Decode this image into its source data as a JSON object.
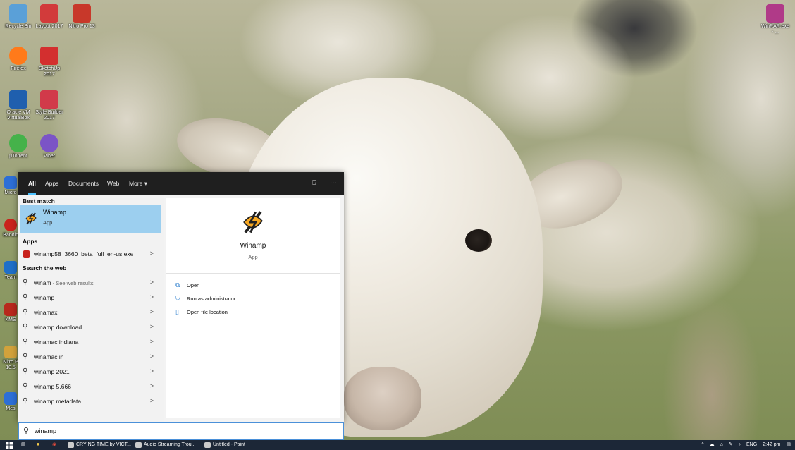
{
  "desktop": {
    "icons": [
      {
        "label": "Recycle Bin",
        "color": "#5aa0d8"
      },
      {
        "label": "Layout 2017",
        "color": "#d23b3b"
      },
      {
        "label": "Nitro Pro 13",
        "color": "#c8382a"
      },
      {
        "label": "Firefox",
        "color": "#ff7a1a"
      },
      {
        "label": "SketchUp 2017",
        "color": "#d32f2f"
      },
      {
        "label": "Oracle VM VirtualBox",
        "color": "#1f5fae"
      },
      {
        "label": "Style Builder 2017",
        "color": "#d13a4a"
      },
      {
        "label": "µTorrent",
        "color": "#45b24a"
      },
      {
        "label": "Viber",
        "color": "#7b54c6"
      },
      {
        "label": "WinRAR.exe - ...",
        "color": "#b03a88"
      }
    ],
    "partial_icons": [
      {
        "label": "Micro",
        "color": "#2d6fd6"
      },
      {
        "label": "Bandic",
        "color": "#c9221b"
      },
      {
        "label": "Team",
        "color": "#1f6fc8"
      },
      {
        "label": "KMS",
        "color": "#b7281c"
      },
      {
        "label": "Nitro P 10.5",
        "color": "#d2a23b"
      },
      {
        "label": "Mes",
        "color": "#2d6fd6"
      }
    ]
  },
  "search": {
    "filters": {
      "tabs": [
        "All",
        "Apps",
        "Documents",
        "Web",
        "More ▾"
      ],
      "active": "All",
      "feedback_icon": "⍈",
      "more_icon": "···"
    },
    "best_match": {
      "heading": "Best match",
      "title": "Winamp",
      "subtitle": "App"
    },
    "apps": {
      "heading": "Apps",
      "items": [
        {
          "label": "winamp58_3660_beta_full_en-us.exe"
        }
      ]
    },
    "web": {
      "heading": "Search the web",
      "items": [
        {
          "label": "winam",
          "sub": " - See web results"
        },
        {
          "label": "winamp",
          "sub": ""
        },
        {
          "label": "winamax",
          "sub": ""
        },
        {
          "label": "winamp download",
          "sub": ""
        },
        {
          "label": "winamac indiana",
          "sub": ""
        },
        {
          "label": "winamac in",
          "sub": ""
        },
        {
          "label": "winamp 2021",
          "sub": ""
        },
        {
          "label": "winamp 5.666",
          "sub": ""
        },
        {
          "label": "winamp metadata",
          "sub": ""
        }
      ]
    },
    "detail": {
      "title": "Winamp",
      "subtitle": "App",
      "actions": [
        {
          "label": "Open",
          "icon": "open-icon"
        },
        {
          "label": "Run as administrator",
          "icon": "shield-icon"
        },
        {
          "label": "Open file location",
          "icon": "file-location-icon"
        }
      ]
    },
    "query": "winamp",
    "accent": "#4cc2ff",
    "highlight": "#9ccfef"
  },
  "taskbar": {
    "apps": [
      {
        "label": "CRYING TIME by VICT..."
      },
      {
        "label": "Audio Streaming Trou..."
      },
      {
        "label": "Untitled - Paint"
      }
    ],
    "tray": {
      "language": "ENG",
      "time": "2:42 pm"
    }
  }
}
